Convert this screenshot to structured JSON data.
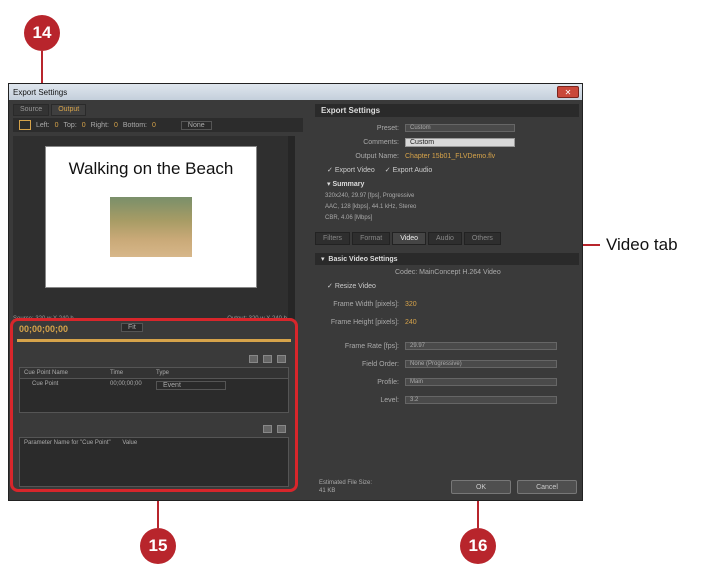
{
  "callouts": {
    "c14": "14",
    "c15": "15",
    "c16": "16"
  },
  "annotation": {
    "video_tab": "Video tab"
  },
  "window": {
    "title": "Export Settings",
    "close": "✕"
  },
  "left": {
    "tabs": [
      "Source",
      "Output"
    ],
    "crop": {
      "left_label": "Left:",
      "left": "0",
      "top_label": "Top:",
      "top": "0",
      "right_label": "Right:",
      "right": "0",
      "bottom_label": "Bottom:",
      "bottom": "0",
      "none": "None"
    },
    "slide_title": "Walking on the Beach",
    "source_dims": "Source: 320 w X 240 h",
    "output_dims": "Output: 320 w X 240 h",
    "timecode": "00;00;00;00",
    "fit": "Fit",
    "cue_headers": [
      "Cue Point Name",
      "Time",
      "Type"
    ],
    "cue_row": [
      "Cue Point",
      "00;00;00;00",
      "Event"
    ],
    "param_headers": [
      "Parameter Name for \"Cue Point\"",
      "Value"
    ]
  },
  "right": {
    "heading": "Export Settings",
    "preset_label": "Preset:",
    "preset": "Custom",
    "comments_label": "Comments:",
    "comments": "Custom",
    "output_label": "Output Name:",
    "output": "Chapter 15b01_FLVDemo.flv",
    "export_video": "Export Video",
    "export_audio": "Export Audio",
    "summary_label": "Summary",
    "summary_lines": [
      "320x240, 29.97 [fps], Progressive",
      "AAC, 128 [kbps], 44.1 kHz, Stereo",
      "CBR, 4.06 [Mbps]"
    ],
    "tabs": [
      "Filters",
      "Format",
      "Video",
      "Audio",
      "Others"
    ],
    "basic_video": "Basic Video Settings",
    "codec": "Codec: MainConcept H.264 Video",
    "resize": "Resize Video",
    "frame_width_label": "Frame Width [pixels]:",
    "frame_width": "320",
    "frame_height_label": "Frame Height [pixels]:",
    "frame_height": "240",
    "frame_rate_label": "Frame Rate [fps]:",
    "frame_rate": "29.97",
    "field_order_label": "Field Order:",
    "field_order": "None (Progressive)",
    "profile_label": "Profile:",
    "profile": "Main",
    "level_label": "Level:",
    "level": "3.2",
    "file_size_label": "Estimated File Size:",
    "file_size": "41 KB",
    "ok": "OK",
    "cancel": "Cancel"
  }
}
